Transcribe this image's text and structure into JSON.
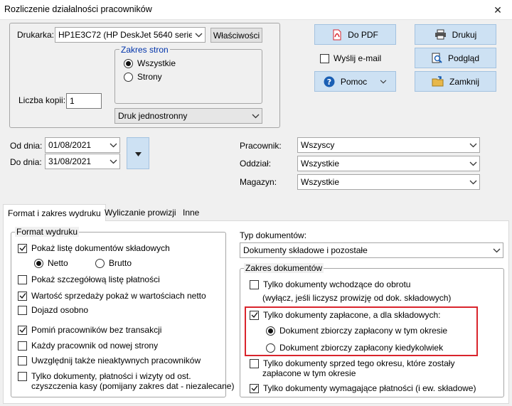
{
  "window": {
    "title": "Rozliczenie działalności pracowników"
  },
  "printer": {
    "label": "Drukarka:",
    "value": "HP1E3C72 (HP DeskJet 5640 series) (K",
    "properties_label": "Właściwości",
    "range_legend": "Zakres stron",
    "range_all": "Wszystkie",
    "range_pages": "Strony",
    "copies_label": "Liczba kopii:",
    "copies_value": "1",
    "duplex_value": "Druk jednostronny"
  },
  "actions": {
    "pdf": "Do PDF",
    "print": "Drukuj",
    "email": "Wyślij e-mail",
    "preview": "Podgląd",
    "help": "Pomoc",
    "close": "Zamknij"
  },
  "dates": {
    "from_label": "Od dnia:",
    "from_value": "01/08/2021",
    "to_label": "Do dnia:",
    "to_value": "31/08/2021"
  },
  "filters": {
    "employee_label": "Pracownik:",
    "employee_value": "Wszyscy",
    "branch_label": "Oddział:",
    "branch_value": "Wszystkie",
    "warehouse_label": "Magazyn:",
    "warehouse_value": "Wszystkie"
  },
  "tabs": [
    "Format i zakres wydruku",
    "Wyliczanie prowizji",
    "Inne"
  ],
  "format": {
    "legend": "Format wydruku",
    "show_docs": "Pokaż listę dokumentów składowych",
    "net": "Netto",
    "gross": "Brutto",
    "show_payments": "Pokaż szczegółową listę płatności",
    "sales_net": "Wartość sprzedaży pokaż w wartościach netto",
    "commute": "Dojazd osobno",
    "skip_no_trans": "Pomiń pracowników bez transakcji",
    "new_page": "Każdy pracownik od nowej strony",
    "inactive": "Uwzględnij także nieaktywnych pracowników",
    "since_clear_1": "Tylko dokumenty, płatności i wizyty od ost.",
    "since_clear_2": "czyszczenia kasy (pomijany zakres dat - niezalecane)"
  },
  "doc_type": {
    "label": "Typ dokumentów:",
    "value": "Dokumenty składowe i pozostałe"
  },
  "doc_range": {
    "legend": "Zakres dokumentów",
    "incoming_1": "Tylko dokumenty wchodzące do obrotu",
    "incoming_2": "(wyłącz, jeśli liczysz prowizję od dok. składowych)",
    "paid": "Tylko dokumenty zapłacone, a dla składowych:",
    "paid_in_period": "Dokument zbiorczy zapłacony w tym okresie",
    "paid_anytime": "Dokument zbiorczy zapłacony kiedykolwiek",
    "before_1": "Tylko dokumenty sprzed tego okresu, które zostały",
    "before_2": "zapłacone w tym okresie",
    "need_payment": "Tylko dokumenty wymagające płatności (i ew. składowe)"
  },
  "colors": {
    "accent_button": "#cde1f3",
    "highlight": "#d9242c",
    "pdf_red": "#d9242c"
  }
}
